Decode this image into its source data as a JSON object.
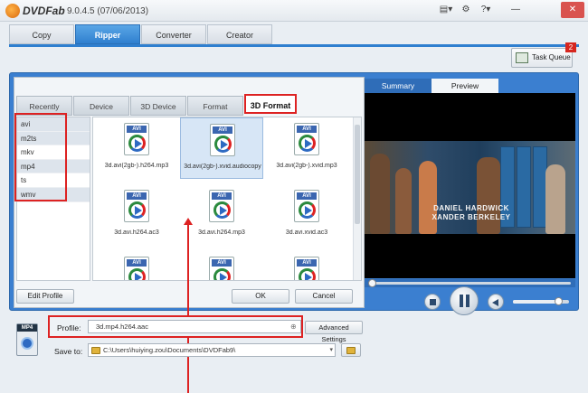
{
  "app": {
    "logo_text": "DVDFab",
    "version": "9.0.4.5 (07/06/2013)"
  },
  "window_controls": {
    "view": "▤▾",
    "settings": "⚙",
    "help": "?▾",
    "minimize": "—",
    "close": "✕"
  },
  "main_tabs": [
    {
      "label": "Copy"
    },
    {
      "label": "Ripper"
    },
    {
      "label": "Converter"
    },
    {
      "label": "Creator"
    }
  ],
  "task_queue": {
    "label": "Task Queue",
    "badge": "2"
  },
  "sub_tabs": [
    {
      "label": "Recently"
    },
    {
      "label": "Device"
    },
    {
      "label": "3D Device"
    },
    {
      "label": "Format"
    },
    {
      "label": "3D Format"
    }
  ],
  "formats": [
    "avi",
    "m2ts",
    "mkv",
    "mp4",
    "ts",
    "wmv"
  ],
  "profiles": [
    {
      "tag": "AVI",
      "label": "3d.avi(2gb-).h264.mp3"
    },
    {
      "tag": "AVI",
      "label": "3d.avi(2gb-).xvid.audiocopy"
    },
    {
      "tag": "AVI",
      "label": "3d.avi(2gb-).xvid.mp3"
    },
    {
      "tag": "AVI",
      "label": "3d.avi.h264.ac3"
    },
    {
      "tag": "AVI",
      "label": "3d.avi.h264.mp3"
    },
    {
      "tag": "AVI",
      "label": "3d.avi.xvid.ac3"
    },
    {
      "tag": "AVI",
      "label": ""
    },
    {
      "tag": "AVI",
      "label": ""
    },
    {
      "tag": "AVI",
      "label": ""
    }
  ],
  "buttons": {
    "edit_profile": "Edit Profile",
    "ok": "OK",
    "cancel": "Cancel",
    "advanced": "Advanced Settings"
  },
  "preview_tabs": [
    {
      "label": "Summary"
    },
    {
      "label": "Preview"
    }
  ],
  "video": {
    "credit_line1": "DANIEL HARDWICK",
    "credit_line2": "XANDER BERKELEY"
  },
  "bottom": {
    "output_tag": "MP4",
    "profile_label": "Profile:",
    "profile_value": "3d.mp4.h264.aac",
    "pin": "⊕",
    "save_label": "Save to:",
    "save_value": "C:\\Users\\huiying.zou\\Documents\\DVDFab9\\",
    "dd": "▾"
  },
  "colors": {
    "accent": "#2f7fcf",
    "highlight": "#dd2222"
  }
}
